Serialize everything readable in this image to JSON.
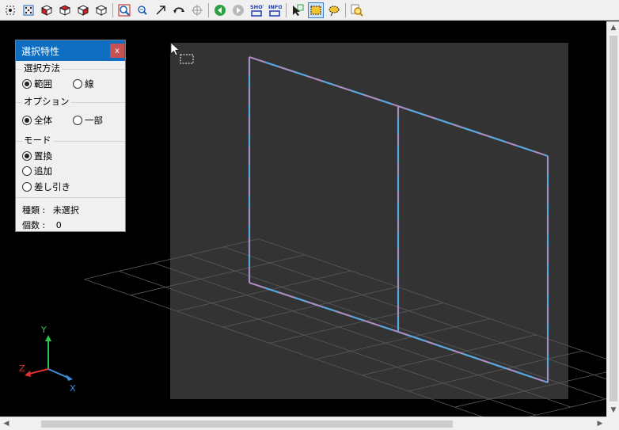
{
  "toolbar": {
    "buttons": [
      {
        "name": "select-all-icon"
      },
      {
        "name": "select-dots-icon"
      },
      {
        "name": "view-cube-front-icon"
      },
      {
        "name": "view-cube-side-icon"
      },
      {
        "name": "view-cube-top-icon"
      },
      {
        "name": "view-cube-wire-icon"
      },
      {
        "name": "zoom-window-icon"
      },
      {
        "name": "zoom-out-icon"
      },
      {
        "name": "pan-arrow-icon"
      },
      {
        "name": "rotate-icon"
      },
      {
        "name": "target-icon"
      },
      {
        "name": "back-icon"
      },
      {
        "name": "forward-icon"
      },
      {
        "name": "shot-icon"
      },
      {
        "name": "info-icon"
      },
      {
        "name": "select-cursor-icon"
      },
      {
        "name": "box-select-icon"
      },
      {
        "name": "lasso-select-icon"
      },
      {
        "name": "search-zoom-icon"
      }
    ],
    "shot_label": "SHOT",
    "info_label": "INFO"
  },
  "panel": {
    "title": "選択特性",
    "close_label": "x",
    "method": {
      "label": "選択方法",
      "options": [
        "範囲",
        "線"
      ],
      "selected": "範囲"
    },
    "option": {
      "label": "オプション",
      "options": [
        "全体",
        "一部"
      ],
      "selected": "全体"
    },
    "mode": {
      "label": "モード",
      "options": [
        "置換",
        "追加",
        "差し引き"
      ],
      "selected": "置換"
    },
    "kind_label": "種類 :",
    "kind_value": "未選択",
    "count_label": "個数 :",
    "count_value": "0"
  },
  "axes": {
    "x_label": "X",
    "y_label": "Y",
    "z_label": "Z"
  },
  "colors": {
    "toolbar_bg": "#f0f0f0",
    "panel_title_bg": "#0f6ec2",
    "close_bg": "#c75050",
    "viewport_bg": "#000000",
    "plane_fill": "#333333",
    "edge_blue": "#5aa8e0",
    "edge_pink": "#e07aa8",
    "grid": "#5a5a5a",
    "axis_x": "#3b8fe0",
    "axis_y": "#2ec44a",
    "axis_z": "#e03030"
  }
}
